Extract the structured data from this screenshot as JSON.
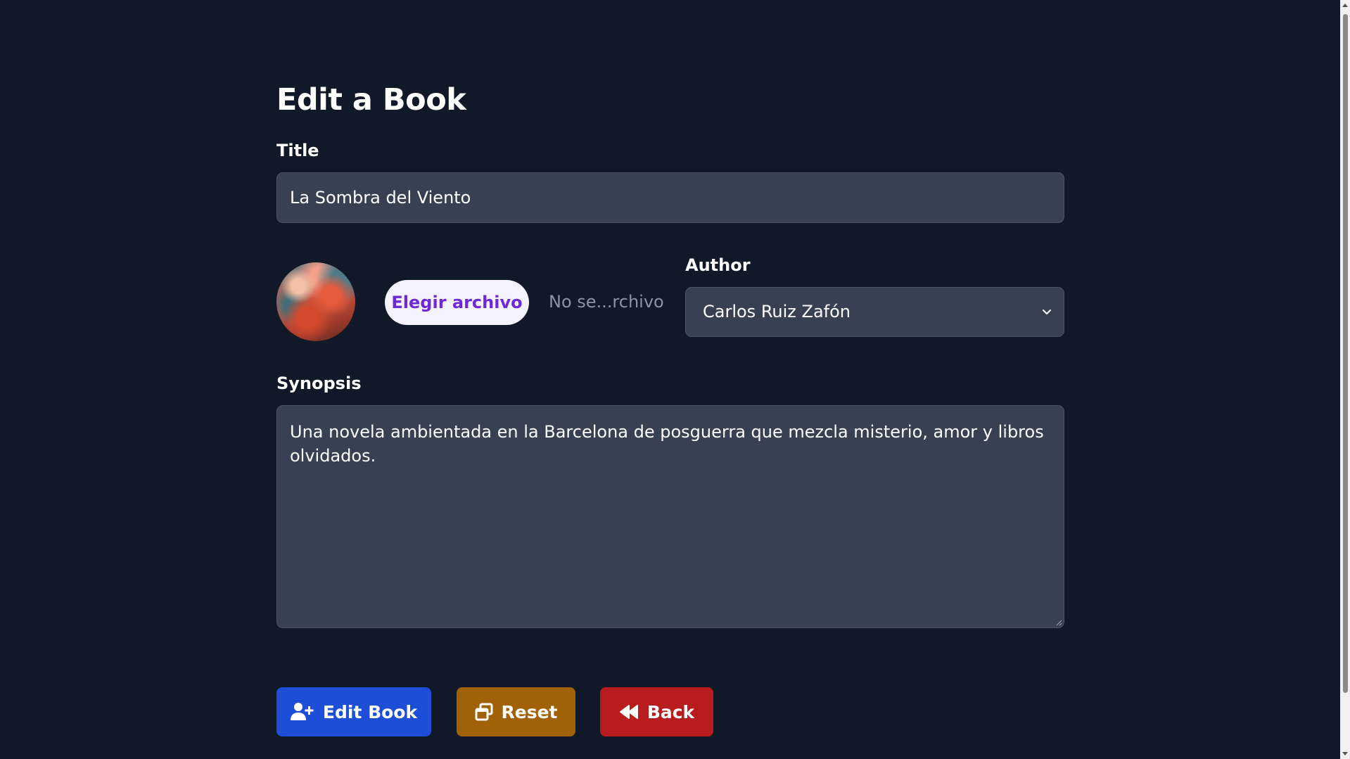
{
  "page": {
    "heading": "Edit a Book"
  },
  "form": {
    "title_label": "Title",
    "title_value": "La Sombra del Viento",
    "file_button_label": "Elegir archivo",
    "file_status": "No se...rchivo",
    "author_label": "Author",
    "author_selected": "Carlos Ruiz Zafón",
    "synopsis_label": "Synopsis",
    "synopsis_value": "Una novela ambientada en la Barcelona de posguerra que mezcla misterio, amor y libros olvidados."
  },
  "actions": {
    "edit_label": "Edit Book",
    "reset_label": "Reset",
    "back_label": "Back"
  },
  "icons": {
    "edit": "user-plus-icon",
    "reset": "window-restore-icon",
    "back": "backward-icon",
    "select": "chevron-down-icon"
  },
  "colors": {
    "background": "#111827",
    "field": "#374151",
    "edit_button": "#1d4ed8",
    "reset_button": "#a16207",
    "back_button": "#b91c1c",
    "file_button_text": "#6d28d9"
  }
}
